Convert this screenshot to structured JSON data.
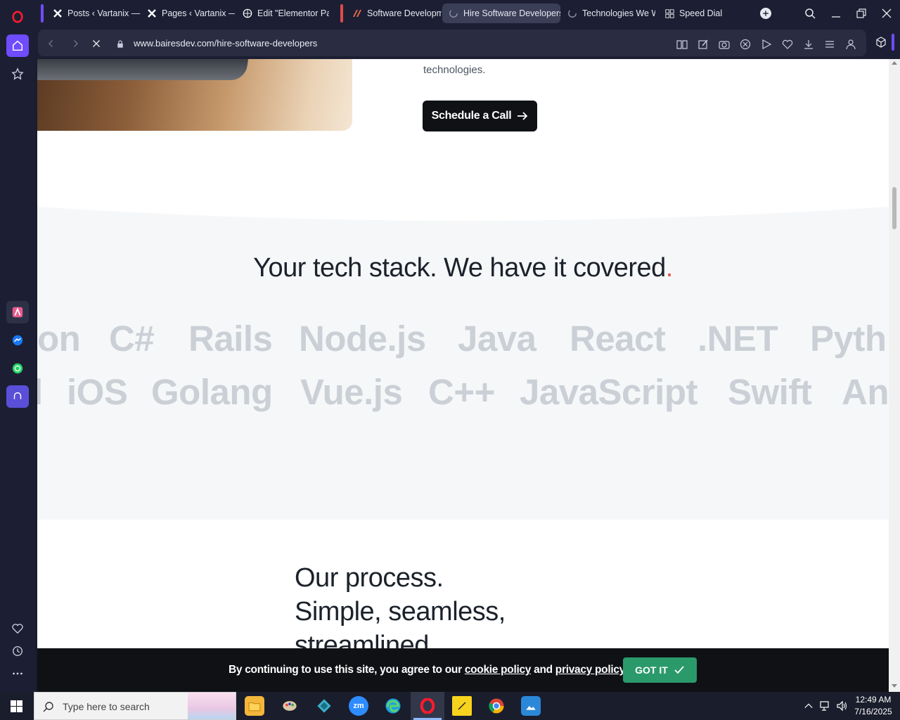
{
  "browser": {
    "tabs": [
      {
        "label": "Posts ‹ Vartanix — W",
        "icon": "wordpress-x-icon"
      },
      {
        "label": "Pages ‹ Vartanix — W",
        "icon": "wordpress-x-icon"
      },
      {
        "label": "Edit \"Elementor Pag",
        "icon": "globe-icon"
      },
      {
        "label": "Software Developm",
        "icon": "bairesdev-icon"
      },
      {
        "label": "Hire Software Developers",
        "icon": "loading-icon"
      },
      {
        "label": "Technologies We W",
        "icon": "loading-icon"
      },
      {
        "label": "Speed Dial",
        "icon": "grid-icon"
      }
    ],
    "url": "www.bairesdev.com/hire-software-developers",
    "colors": {
      "accent": "#6f4cff",
      "group_red": "#e14a4a"
    }
  },
  "page": {
    "intro_tail": "technologies.",
    "cta_label": "Schedule a Call",
    "stack_title": "Your tech stack. We have it covered",
    "stack_title_dot": ".",
    "tech_row1": [
      "on",
      "C#",
      "Rails",
      "Node.js",
      "Java",
      "React",
      ".NET",
      "Pyth"
    ],
    "tech_row2": [
      "l",
      "iOS",
      "Golang",
      "Vue.js",
      "C++",
      "JavaScript",
      "Swift",
      "An"
    ],
    "process_line1": "Our process.",
    "process_line2": "Simple, seamless,",
    "process_line3": "streamlined."
  },
  "cookie": {
    "text_before": "By continuing to use this site, you agree to our ",
    "cookie_link": "cookie policy",
    "text_mid": " and ",
    "privacy_link": "privacy policy",
    "text_after": ".",
    "button": "GOT IT"
  },
  "taskbar": {
    "search_placeholder": "Type here to search",
    "time": "12:49 AM",
    "date": "7/16/2025"
  }
}
